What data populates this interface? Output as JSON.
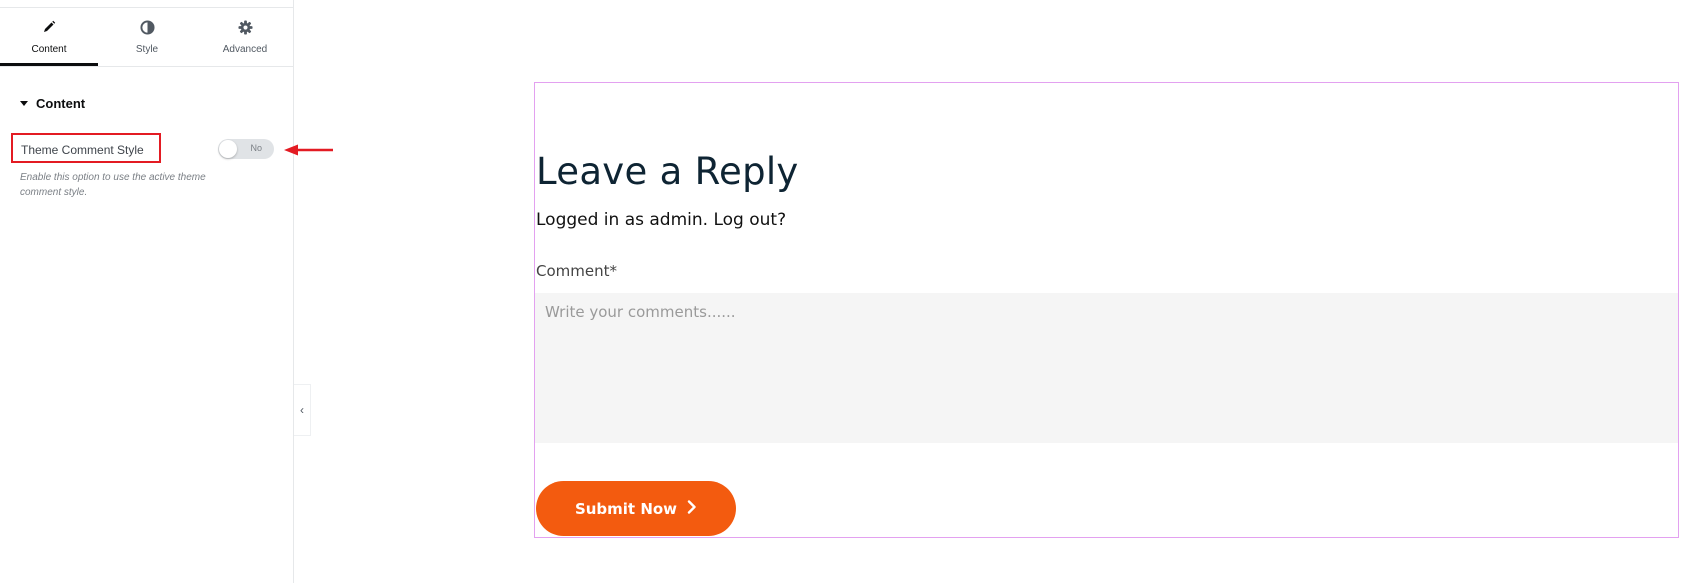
{
  "tabs": [
    {
      "label": "Content",
      "icon": "pencil-icon",
      "active": true
    },
    {
      "label": "Style",
      "icon": "half-circle-icon",
      "active": false
    },
    {
      "label": "Advanced",
      "icon": "gear-icon",
      "active": false
    }
  ],
  "section": {
    "title": "Content"
  },
  "control": {
    "label": "Theme Comment Style",
    "toggle_text": "No",
    "toggle_on": false,
    "help": "Enable this option to use the active theme comment style."
  },
  "colors": {
    "highlight_border": "#e31b23",
    "submit_bg": "#f35b0f",
    "widget_outline": "#e3a1f0"
  },
  "preview": {
    "title": "Leave a Reply",
    "logged_in_text": "Logged in as admin.",
    "logout_link": "Log out?",
    "comment_label": "Comment*",
    "comment_placeholder": "Write your comments......",
    "submit_label": "Submit Now"
  }
}
